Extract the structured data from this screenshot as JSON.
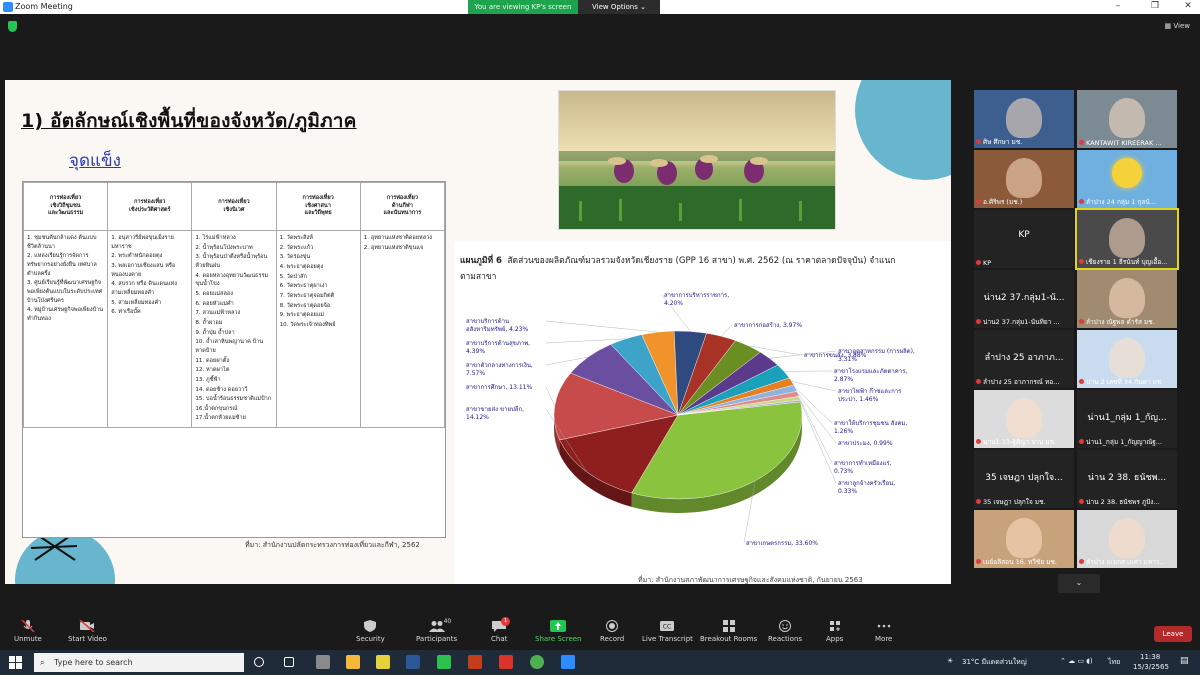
{
  "window": {
    "title": "Zoom Meeting",
    "minimize": "–",
    "maximize": "❐",
    "close": "✕"
  },
  "banner": {
    "viewing": "You are viewing KP's screen",
    "view_options": "View Options ⌄"
  },
  "view_label": "View",
  "slide": {
    "heading": "1) อัตลักษณ์เชิงพื้นที่ของจังหวัด/ภูมิภาค",
    "subheading": "จุดแข็ง",
    "table": {
      "headers": [
        "การท่องเที่ยว\nเชิงวิถีชุมชน\nและวัฒนธรรม",
        "การท่องเที่ยว\nเชิงประวัติศาสตร์",
        "การท่องเที่ยว\nเชิงนิเวศ",
        "การท่องเที่ยว\nเชิงศาสนา\nและวิถีพุทธ",
        "การท่องเที่ยว\nด้านกีฬา\nและนันทนาการ"
      ],
      "columns": [
        [
          "1. ชุมชนต้นกล้าแดง ต้นแบบชีวิตล้านนา",
          "2. แหล่งเรียนรู้การจัดการทรัพยากรอย่างยั่งยืน เทศบาลตำบลครึ่ง",
          "3. ศูนย์เรียนรู้ที่พัฒนาเศรษฐกิจพอเพียงต้นแบบในระดับประเทศ บ้านโป่งศรีนคร",
          "4. หมู่บ้านเศรษฐกิจพอเพียงบ้านทำกินทอง"
        ],
        [
          "1. อนุสาวรีย์พ่อขุนเม็งรายมหาราช",
          "2. พระตำหนักดอยตุง",
          "3. พลเอกามเชียงแสน หรือหนองบงคาย",
          "4. สบรวก หรือ ดินแดนแห่งสามเหลี่ยมทองคำ",
          "5. สามเหลี่ยมทองคำ",
          "6. ท่าเรือบั๊ค"
        ],
        [
          "1. ไร่แม่ฟ้าหลวง",
          "2. น้ำพุร้อนโป่งพระบาท",
          "3. น้ำพุร้อนป่าตึงหรือน้ำพุร้อนห้วยหินฝน",
          "4. ดอยหลวงอุทยานวัฒนธรรมขุนน้ำโขง",
          "5. ดอยแม่สลอง",
          "6. ดอยหัวแม่คำ",
          "7. สวนแม่ฟ้าหลวง",
          "8. ถ้ำผาอม",
          "9. ถ้ำปุ่ม ถ้ำปลา",
          "10. ถ้ำเสาหินพญานาค บ้านหาดบ้าย",
          "11. ดอยผาตั้ง",
          "12. หาดผาไต",
          "13. ภูชี้ฟ้า",
          "14. ดอยช้าง ดอยวาวี",
          "15. บ่อน้ำร้อนธรรมชาติแม่ป้าก",
          "16.น้ำตกขุนกรณ์",
          "17.น้ำตกห้วยแม่ซ้าย"
        ],
        [
          "1. วัดพระสิงห์",
          "2. วัดพระแก้ว",
          "3. วัดร่องขุ่น",
          "4. พระธาตุดอยตุง",
          "5. วัดป่าสัก",
          "6. วัดพระธาตุผาเงา",
          "7. วัดพระธาตุจอมกิตติ",
          "8. วัดพระธาตุดอยจ้อ",
          "9. พระธาตุดอยแม่",
          "10. วัดพระเจ้าทองทิพย์"
        ],
        [
          "1. อุทยานแห่งชาติดอยหลวง",
          "2. อุทยานแห่งชาติขุนแจ"
        ]
      ],
      "source": "ที่มา: สำนักงานปลัดกระทรวงการท่องเที่ยวและกีฬา, 2562"
    },
    "chart_title_prefix": "แผนภูมิที่ 6",
    "chart_title_rest": "สัดส่วนของผลิตภัณฑ์มวลรวมจังหวัดเชียงราย (GPP 16  สาขา) พ.ศ. 2562 (ณ ราคาตลาดปัจจุบัน) จำแนกตามสาขา",
    "chart_source": "ที่มา: สำนักงานสภาพัฒนาการเศรษฐกิจและสังคมแห่งชาติ, กันยายน 2563"
  },
  "chart_data": {
    "type": "pie",
    "title": "สัดส่วนของผลิตภัณฑ์มวลรวมจังหวัดเชียงราย (GPP 16  สาขา) พ.ศ. 2562 (ณ ราคาตลาดปัจจุบัน) จำแนกตามสาขา",
    "slices": [
      {
        "name": "สาขาเกษตรกรรม",
        "value": 33.6,
        "label": "สาขาเกษตรกรรม, 33.60%",
        "color": "#8ac43f"
      },
      {
        "name": "สาขาขายส่ง ขายปลีก",
        "value": 14.12,
        "label": "สาขาขายส่ง ขายปลีก,\n14.12%",
        "color": "#8f1f1f"
      },
      {
        "name": "สาขาการศึกษา",
        "value": 13.11,
        "label": "สาขาการศึกษา, 13.11%",
        "color": "#c74b4b"
      },
      {
        "name": "สาขาตัวกลางทางการเงิน",
        "value": 7.57,
        "label": "สาขาตัวกลางทางการเงิน,\n7.57%",
        "color": "#6a4fa0"
      },
      {
        "name": "สาขาบริการด้านสุขภาพ",
        "value": 4.39,
        "label": "สาขาบริการด้านสุขภาพ,\n4.39%",
        "color": "#3da3c9"
      },
      {
        "name": "สาขาบริการด้านอสังหาริมทรัพย์",
        "value": 4.23,
        "label": "สาขาบริการด้าน\nอสังหาริมทรัพย์, 4.23%",
        "color": "#f0932b"
      },
      {
        "name": "สาขาการบริหารราชการ",
        "value": 4.2,
        "label": "สาขาการบริหารราชการ,\n4.20%",
        "color": "#2e4a7e"
      },
      {
        "name": "สาขาการก่อสร้าง",
        "value": 3.97,
        "label": "สาขาการก่อสร้าง, 3.97%",
        "color": "#a93226"
      },
      {
        "name": "สาขาการขนส่ง",
        "value": 3.88,
        "label": "สาขาการขนส่ง, 3.88%",
        "color": "#6b8e23"
      },
      {
        "name": "สาขาอุตสาหกรรม (การผลิต)",
        "value": 3.31,
        "label": "สาขาอุตสาหกรรม (การผลิต),\n3.31%",
        "color": "#5b3a8c"
      },
      {
        "name": "สาขาโรงแรมและภัตตาคาร",
        "value": 2.87,
        "label": "สาขาโรงแรมและภัตตาคาร,\n2.87%",
        "color": "#1aa0b8"
      },
      {
        "name": "สาขาไฟฟ้า ก๊าซและการประปา",
        "value": 1.46,
        "label": "สาขาไฟฟ้า ก๊าซและการ\nประปา, 1.46%",
        "color": "#e67e22"
      },
      {
        "name": "สาขาให้บริการชุมชน สังคม",
        "value": 1.26,
        "label": "สาขาให้บริการชุมชน สังคม,\n1.26%",
        "color": "#8fb3e0"
      },
      {
        "name": "สาขาประมง",
        "value": 0.99,
        "label": "สาขาประมง, 0.99%",
        "color": "#e08a8a"
      },
      {
        "name": "สาขาการทำเหมืองแร่",
        "value": 0.73,
        "label": "สาขาการทำเหมืองแร่,\n0.73%",
        "color": "#c9d88a"
      },
      {
        "name": "สาขาลูกจ้างครัวเรือน",
        "value": 0.33,
        "label": "สาขาลูกจ้างครัวเรือน,\n0.33%",
        "color": "#b49fd4"
      }
    ]
  },
  "participants": [
    {
      "label": "ศิษ ศึกษา มช.",
      "kind": "photo",
      "color": "#3d5f8f"
    },
    {
      "label": "KANTAWIT KIREERAK ...",
      "kind": "photo",
      "color": "#7c8a93"
    },
    {
      "label": "อ.ศิริพร (มช.)",
      "kind": "photo",
      "color": "#8a5a3a"
    },
    {
      "label": "ลำปาง 24 กลุ่ม 1 กุลนั...",
      "kind": "sun",
      "color": "#6fb0e0"
    },
    {
      "label": "KP",
      "kind": "name",
      "big": "KP",
      "color": "#232323"
    },
    {
      "label": "เชียงราย 1 ธีรนันท์ บุญเอื้อ...",
      "kind": "photo",
      "color": "#4a4a4a",
      "active": true
    },
    {
      "label": "น่าน2 37.กลุ่ม1-นันทิยา ...",
      "kind": "name",
      "big": "น่าน2 37.กลุ่ม1-นั...",
      "color": "#232323"
    },
    {
      "label": "ลำปาง ณัฐพล ดำรัส มช.",
      "kind": "photo",
      "color": "#a08a70"
    },
    {
      "label": "ลำปาง 25 อาภากรณ์ ทอ...",
      "kind": "name",
      "big": "ลำปาง 25 อาภาภ...",
      "color": "#232323"
    },
    {
      "label": "น่าน 2 เลขที่ 34 กันดา มช.",
      "kind": "photo",
      "color": "#c9dcef"
    },
    {
      "label": "น่าน1 33-ฐิติญา จาน มช.",
      "kind": "photo",
      "color": "#dcdcdc"
    },
    {
      "label": "น่าน1_กลุ่ม 1_กัญญาณัฐ...",
      "kind": "name",
      "big": "น่าน1_กลุ่ม 1_กัญ...",
      "color": "#232323"
    },
    {
      "label": "35 เจษฎา ปลุกใจ มช.",
      "kind": "name",
      "big": "35 เจษฎา ปลุกใจ...",
      "color": "#232323"
    },
    {
      "label": "น่าน 2 38. ธนัชพร ภูปัง...",
      "kind": "name",
      "big": "น่าน 2 38. ธนัชพ...",
      "color": "#232323"
    },
    {
      "label": "เมย์อลิสอน 16. ทวีชัย มช.",
      "kind": "photo",
      "color": "#c7a27a"
    },
    {
      "label": "ลำปาง อเนกส เมศา มหาว...",
      "kind": "photo",
      "color": "#d8d8d8"
    }
  ],
  "toolbar": {
    "unmute": "Unmute",
    "start_video": "Start Video",
    "security": "Security",
    "participants": "Participants",
    "participants_count": "40",
    "chat": "Chat",
    "chat_badge": "1",
    "share_screen": "Share Screen",
    "record": "Record",
    "live_transcript": "Live Transcript",
    "breakout_rooms": "Breakout Rooms",
    "reactions": "Reactions",
    "apps": "Apps",
    "more": "More",
    "leave": "Leave"
  },
  "taskbar": {
    "search_placeholder": "Type here to search",
    "weather": "31°C  มีแดดส่วนใหญ่",
    "lang": "ไทย",
    "time": "11:38",
    "date": "15/3/2565"
  }
}
